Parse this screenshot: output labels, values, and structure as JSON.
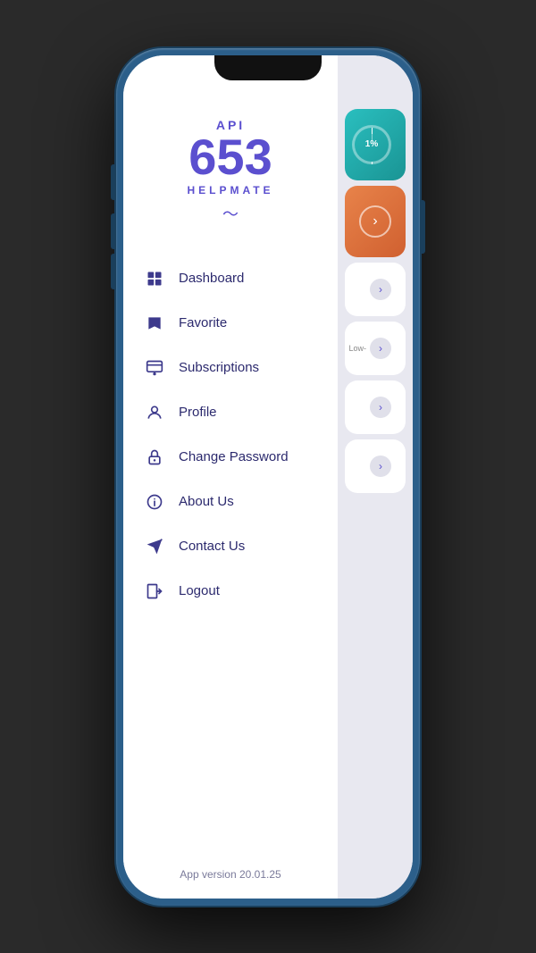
{
  "app": {
    "logo_api": "API",
    "logo_number": "653",
    "logo_name": "HELPMATE",
    "version": "App version 20.01.25"
  },
  "menu": {
    "items": [
      {
        "id": "dashboard",
        "label": "Dashboard",
        "icon": "dashboard-icon"
      },
      {
        "id": "favorite",
        "label": "Favorite",
        "icon": "favorite-icon"
      },
      {
        "id": "subscriptions",
        "label": "Subscriptions",
        "icon": "subscriptions-icon"
      },
      {
        "id": "profile",
        "label": "Profile",
        "icon": "profile-icon"
      },
      {
        "id": "change-password",
        "label": "Change Password",
        "icon": "lock-icon"
      },
      {
        "id": "about-us",
        "label": "About Us",
        "icon": "info-icon"
      },
      {
        "id": "contact-us",
        "label": "Contact Us",
        "icon": "send-icon"
      },
      {
        "id": "logout",
        "label": "Logout",
        "icon": "logout-icon"
      }
    ]
  },
  "cards": {
    "progress_label": "1%",
    "low_label": "Low-"
  }
}
